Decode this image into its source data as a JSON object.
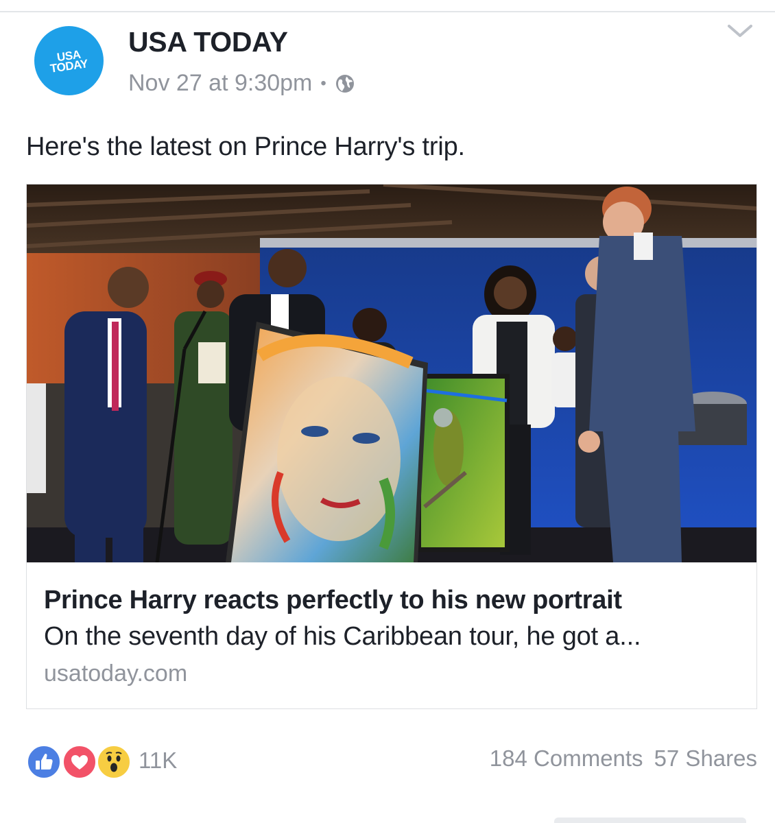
{
  "post": {
    "page_name": "USA TODAY",
    "avatar": {
      "line1": "USA",
      "line2": "TODAY",
      "color": "#1ea0e8"
    },
    "timestamp": "Nov 27 at 9:30pm",
    "separator": "•",
    "privacy_icon": "globe-icon",
    "text": "Here's the latest on Prince Harry's trip."
  },
  "link_card": {
    "title": "Prince Harry reacts perfectly to his new portrait",
    "description": "On the seventh day of his Caribbean tour, he got a...",
    "domain": "usatoday.com"
  },
  "footer": {
    "reaction_icons": [
      "like-icon",
      "love-icon",
      "wow-icon"
    ],
    "reaction_count": "11K",
    "comments": "184 Comments",
    "shares": "57 Shares"
  },
  "colors": {
    "brand_blue": "#1ea0e8",
    "like_blue": "#4c7fe3",
    "love_red": "#f25268",
    "wow_yellow": "#f7cd42",
    "meta_gray": "#90949c"
  }
}
